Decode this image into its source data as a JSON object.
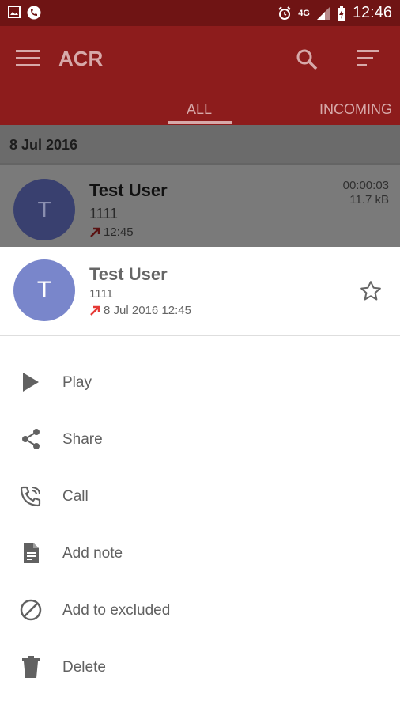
{
  "statusbar": {
    "time": "12:46",
    "network": "4G",
    "icons": [
      "image-icon",
      "phone-circle-icon",
      "alarm-icon",
      "signal-icon",
      "battery-charging-icon"
    ]
  },
  "appbar": {
    "title": "ACR",
    "tabs": [
      {
        "label": "ALL",
        "selected": true
      },
      {
        "label": "INCOMING",
        "selected": false
      }
    ]
  },
  "list": {
    "date_header": "8 Jul 2016",
    "item": {
      "avatar_letter": "T",
      "name": "Test User",
      "number": "1111",
      "time": "12:45",
      "duration": "00:00:03",
      "size": "11.7 kB"
    }
  },
  "sheet": {
    "avatar_letter": "T",
    "name": "Test User",
    "number": "1111",
    "datetime": "8 Jul 2016 12:45",
    "actions": [
      {
        "label": "Play",
        "icon": "play-icon"
      },
      {
        "label": "Share",
        "icon": "share-icon"
      },
      {
        "label": "Call",
        "icon": "call-icon"
      },
      {
        "label": "Add note",
        "icon": "note-icon"
      },
      {
        "label": "Add to excluded",
        "icon": "block-icon"
      },
      {
        "label": "Delete",
        "icon": "trash-icon"
      }
    ]
  },
  "colors": {
    "statusbar": "#6f1414",
    "appbar": "#8d1c1c",
    "avatar": "#7986cb",
    "outgoing_arrow": "#e53935"
  }
}
